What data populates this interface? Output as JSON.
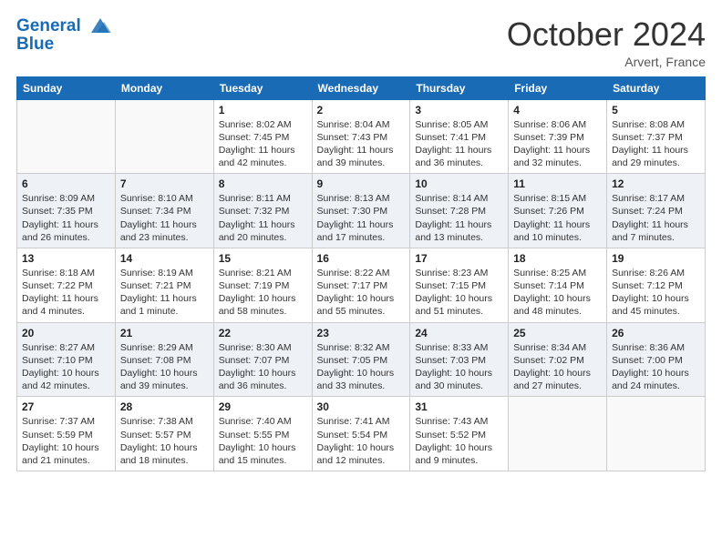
{
  "header": {
    "logo_line1": "General",
    "logo_line2": "Blue",
    "month": "October 2024",
    "location": "Arvert, France"
  },
  "weekdays": [
    "Sunday",
    "Monday",
    "Tuesday",
    "Wednesday",
    "Thursday",
    "Friday",
    "Saturday"
  ],
  "weeks": [
    [
      {
        "day": "",
        "empty": true
      },
      {
        "day": "",
        "empty": true
      },
      {
        "day": "1",
        "sunrise": "Sunrise: 8:02 AM",
        "sunset": "Sunset: 7:45 PM",
        "daylight": "Daylight: 11 hours and 42 minutes."
      },
      {
        "day": "2",
        "sunrise": "Sunrise: 8:04 AM",
        "sunset": "Sunset: 7:43 PM",
        "daylight": "Daylight: 11 hours and 39 minutes."
      },
      {
        "day": "3",
        "sunrise": "Sunrise: 8:05 AM",
        "sunset": "Sunset: 7:41 PM",
        "daylight": "Daylight: 11 hours and 36 minutes."
      },
      {
        "day": "4",
        "sunrise": "Sunrise: 8:06 AM",
        "sunset": "Sunset: 7:39 PM",
        "daylight": "Daylight: 11 hours and 32 minutes."
      },
      {
        "day": "5",
        "sunrise": "Sunrise: 8:08 AM",
        "sunset": "Sunset: 7:37 PM",
        "daylight": "Daylight: 11 hours and 29 minutes."
      }
    ],
    [
      {
        "day": "6",
        "sunrise": "Sunrise: 8:09 AM",
        "sunset": "Sunset: 7:35 PM",
        "daylight": "Daylight: 11 hours and 26 minutes."
      },
      {
        "day": "7",
        "sunrise": "Sunrise: 8:10 AM",
        "sunset": "Sunset: 7:34 PM",
        "daylight": "Daylight: 11 hours and 23 minutes."
      },
      {
        "day": "8",
        "sunrise": "Sunrise: 8:11 AM",
        "sunset": "Sunset: 7:32 PM",
        "daylight": "Daylight: 11 hours and 20 minutes."
      },
      {
        "day": "9",
        "sunrise": "Sunrise: 8:13 AM",
        "sunset": "Sunset: 7:30 PM",
        "daylight": "Daylight: 11 hours and 17 minutes."
      },
      {
        "day": "10",
        "sunrise": "Sunrise: 8:14 AM",
        "sunset": "Sunset: 7:28 PM",
        "daylight": "Daylight: 11 hours and 13 minutes."
      },
      {
        "day": "11",
        "sunrise": "Sunrise: 8:15 AM",
        "sunset": "Sunset: 7:26 PM",
        "daylight": "Daylight: 11 hours and 10 minutes."
      },
      {
        "day": "12",
        "sunrise": "Sunrise: 8:17 AM",
        "sunset": "Sunset: 7:24 PM",
        "daylight": "Daylight: 11 hours and 7 minutes."
      }
    ],
    [
      {
        "day": "13",
        "sunrise": "Sunrise: 8:18 AM",
        "sunset": "Sunset: 7:22 PM",
        "daylight": "Daylight: 11 hours and 4 minutes."
      },
      {
        "day": "14",
        "sunrise": "Sunrise: 8:19 AM",
        "sunset": "Sunset: 7:21 PM",
        "daylight": "Daylight: 11 hours and 1 minute."
      },
      {
        "day": "15",
        "sunrise": "Sunrise: 8:21 AM",
        "sunset": "Sunset: 7:19 PM",
        "daylight": "Daylight: 10 hours and 58 minutes."
      },
      {
        "day": "16",
        "sunrise": "Sunrise: 8:22 AM",
        "sunset": "Sunset: 7:17 PM",
        "daylight": "Daylight: 10 hours and 55 minutes."
      },
      {
        "day": "17",
        "sunrise": "Sunrise: 8:23 AM",
        "sunset": "Sunset: 7:15 PM",
        "daylight": "Daylight: 10 hours and 51 minutes."
      },
      {
        "day": "18",
        "sunrise": "Sunrise: 8:25 AM",
        "sunset": "Sunset: 7:14 PM",
        "daylight": "Daylight: 10 hours and 48 minutes."
      },
      {
        "day": "19",
        "sunrise": "Sunrise: 8:26 AM",
        "sunset": "Sunset: 7:12 PM",
        "daylight": "Daylight: 10 hours and 45 minutes."
      }
    ],
    [
      {
        "day": "20",
        "sunrise": "Sunrise: 8:27 AM",
        "sunset": "Sunset: 7:10 PM",
        "daylight": "Daylight: 10 hours and 42 minutes."
      },
      {
        "day": "21",
        "sunrise": "Sunrise: 8:29 AM",
        "sunset": "Sunset: 7:08 PM",
        "daylight": "Daylight: 10 hours and 39 minutes."
      },
      {
        "day": "22",
        "sunrise": "Sunrise: 8:30 AM",
        "sunset": "Sunset: 7:07 PM",
        "daylight": "Daylight: 10 hours and 36 minutes."
      },
      {
        "day": "23",
        "sunrise": "Sunrise: 8:32 AM",
        "sunset": "Sunset: 7:05 PM",
        "daylight": "Daylight: 10 hours and 33 minutes."
      },
      {
        "day": "24",
        "sunrise": "Sunrise: 8:33 AM",
        "sunset": "Sunset: 7:03 PM",
        "daylight": "Daylight: 10 hours and 30 minutes."
      },
      {
        "day": "25",
        "sunrise": "Sunrise: 8:34 AM",
        "sunset": "Sunset: 7:02 PM",
        "daylight": "Daylight: 10 hours and 27 minutes."
      },
      {
        "day": "26",
        "sunrise": "Sunrise: 8:36 AM",
        "sunset": "Sunset: 7:00 PM",
        "daylight": "Daylight: 10 hours and 24 minutes."
      }
    ],
    [
      {
        "day": "27",
        "sunrise": "Sunrise: 7:37 AM",
        "sunset": "Sunset: 5:59 PM",
        "daylight": "Daylight: 10 hours and 21 minutes."
      },
      {
        "day": "28",
        "sunrise": "Sunrise: 7:38 AM",
        "sunset": "Sunset: 5:57 PM",
        "daylight": "Daylight: 10 hours and 18 minutes."
      },
      {
        "day": "29",
        "sunrise": "Sunrise: 7:40 AM",
        "sunset": "Sunset: 5:55 PM",
        "daylight": "Daylight: 10 hours and 15 minutes."
      },
      {
        "day": "30",
        "sunrise": "Sunrise: 7:41 AM",
        "sunset": "Sunset: 5:54 PM",
        "daylight": "Daylight: 10 hours and 12 minutes."
      },
      {
        "day": "31",
        "sunrise": "Sunrise: 7:43 AM",
        "sunset": "Sunset: 5:52 PM",
        "daylight": "Daylight: 10 hours and 9 minutes."
      },
      {
        "day": "",
        "empty": true
      },
      {
        "day": "",
        "empty": true
      }
    ]
  ]
}
